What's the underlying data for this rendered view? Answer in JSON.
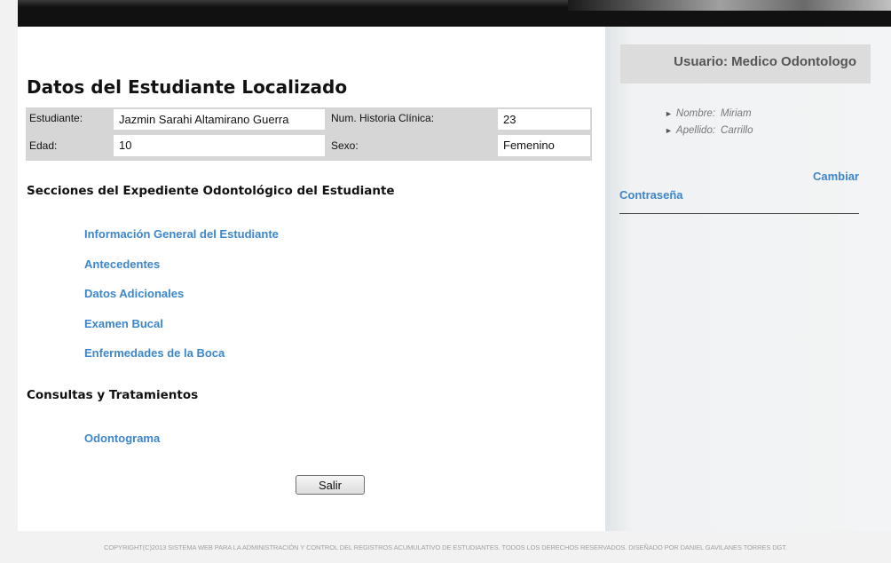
{
  "student": {
    "title": "Datos del Estudiante Localizado",
    "labels": {
      "estudiante": "Estudiante:",
      "historia": "Num. Historia Clínica:",
      "edad": "Edad:",
      "sexo": "Sexo:"
    },
    "values": {
      "estudiante": "Jazmin Sarahi Altamirano Guerra",
      "historia": "23",
      "edad": "10",
      "sexo": "Femenino"
    }
  },
  "sections": {
    "heading": "Secciones del Expediente Odontológico del Estudiante",
    "links": [
      "Información General del Estudiante",
      "Antecedentes",
      "Datos Adicionales",
      "Examen Bucal",
      "Enfermedades de la Boca"
    ]
  },
  "consultas": {
    "heading": "Consultas y Tratamientos",
    "links": [
      "Odontograma"
    ]
  },
  "actions": {
    "salir_label": "Salir"
  },
  "sidebar": {
    "user_title": "Usuario:  Medico Odontologo",
    "nombre_label": "Nombre:",
    "nombre_value": "Miriam",
    "apellido_label": "Apellido:",
    "apellido_value": "Carrillo",
    "arrow_glyph": "►",
    "change_password_line1": "Cambiar",
    "change_password_line2": "Contraseña"
  },
  "footer": {
    "text": "COPYRIGHT(C)2013 SISTEMA WEB PARA LA ADMINISTRACIÓN Y CONTROL DEL REGISTROS ACUMULATIVO DE ESTUDIANTES. TODOS LOS DERECHOS RESERVADOS. DISEÑADO POR DANIEL GAVILANES TORRES DGT."
  },
  "colors": {
    "link": "#3d86c8",
    "sidebar_box": "#dcdcdc",
    "table_bg": "#d6d6d6",
    "topbar": "#111111"
  }
}
